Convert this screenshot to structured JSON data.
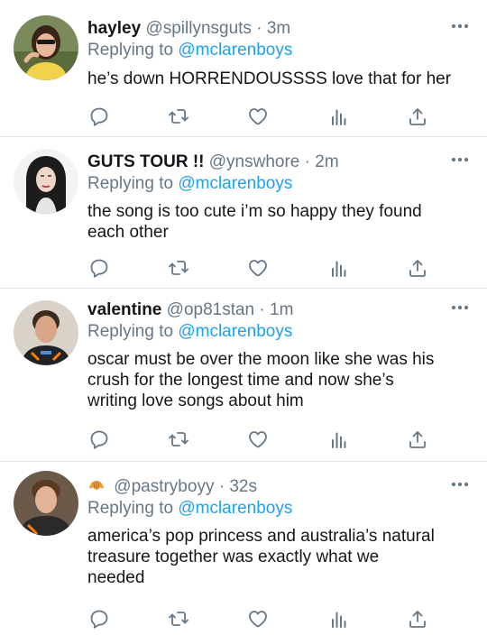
{
  "colors": {
    "text": "#14171a",
    "secondary": "#657786",
    "link": "#1da1f2",
    "divider": "#e1e8ed"
  },
  "tweets": [
    {
      "name": "hayley",
      "handle": "@spillynsguts",
      "dot": "·",
      "time": "3m",
      "reply_prefix": "Replying to",
      "reply_to": "@mclarenboys",
      "text": "he’s down HORRENDOUSSSS love that for her"
    },
    {
      "name": "GUTS TOUR !!",
      "handle": "@ynswhore",
      "dot": "·",
      "time": "2m",
      "reply_prefix": "Replying to",
      "reply_to": "@mclarenboys",
      "text": "the song is too cute i’m so happy they found\neach other"
    },
    {
      "name": "valentine",
      "handle": "@op81stan",
      "dot": "·",
      "time": "1m",
      "reply_prefix": "Replying to",
      "reply_to": "@mclarenboys",
      "text": "oscar must be over the moon like she was his\ncrush for the longest time and now she’s\nwriting love songs about him"
    },
    {
      "name_icon": "croissant-icon",
      "handle": "@pastryboyy",
      "dot": "·",
      "time": "32s",
      "reply_prefix": "Replying to",
      "reply_to": "@mclarenboys",
      "text": "america’s pop princess and australia’s natural\ntreasure together was exactly what we\nneeded"
    }
  ],
  "action_icons": [
    "reply-icon",
    "retweet-icon",
    "like-icon",
    "analytics-icon",
    "share-icon"
  ]
}
